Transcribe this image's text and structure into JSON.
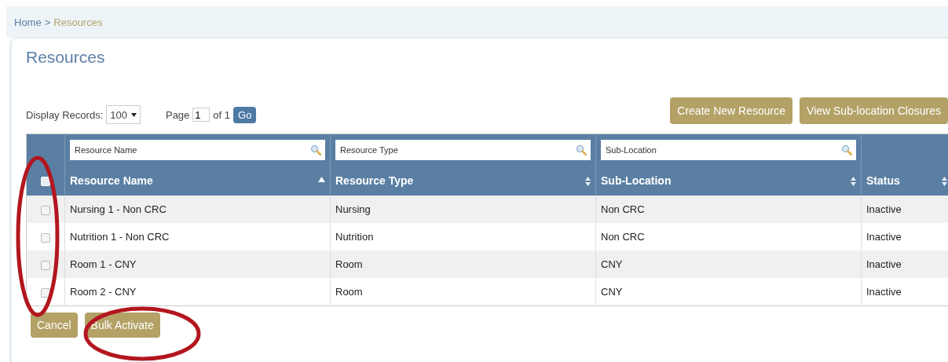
{
  "breadcrumb": [
    {
      "label": "Home",
      "current": false
    },
    {
      "label": "Resources",
      "current": true
    }
  ],
  "breadcrumb_separator": ">",
  "title": "Resources",
  "display_records": {
    "label": "Display Records:",
    "value": "100"
  },
  "pager": {
    "label": "Page",
    "value": "1",
    "of": "of 1",
    "go": "Go"
  },
  "actions": [
    "Create New Resource",
    "View Sub-location Closures"
  ],
  "table": {
    "select_all_checked": false,
    "columns": [
      {
        "label": "Resource Name",
        "filter_placeholder": "Resource Name",
        "sorted": true
      },
      {
        "label": "Resource Type",
        "filter_placeholder": "Resource Type",
        "sorted": false
      },
      {
        "label": "Sub-Location",
        "filter_placeholder": "Sub-Location",
        "sorted": false
      },
      {
        "label": "Status",
        "sorted": false
      }
    ],
    "rows": [
      {
        "checked": false,
        "cells": [
          "Nursing 1 - Non CRC",
          "Nursing",
          "Non CRC",
          "Inactive"
        ]
      },
      {
        "checked": false,
        "cells": [
          "Nutrition 1 - Non CRC",
          "Nutrition",
          "Non CRC",
          "Inactive"
        ]
      },
      {
        "checked": false,
        "cells": [
          "Room 1 - CNY",
          "Room",
          "CNY",
          "Inactive"
        ]
      },
      {
        "checked": false,
        "cells": [
          "Room 2 - CNY",
          "Room",
          "CNY",
          "Inactive"
        ]
      }
    ]
  },
  "footer_buttons": [
    "Cancel",
    "Bulk Activate"
  ],
  "annotations": [
    {
      "kind": "ellipse"
    },
    {
      "kind": "ellipse"
    }
  ]
}
